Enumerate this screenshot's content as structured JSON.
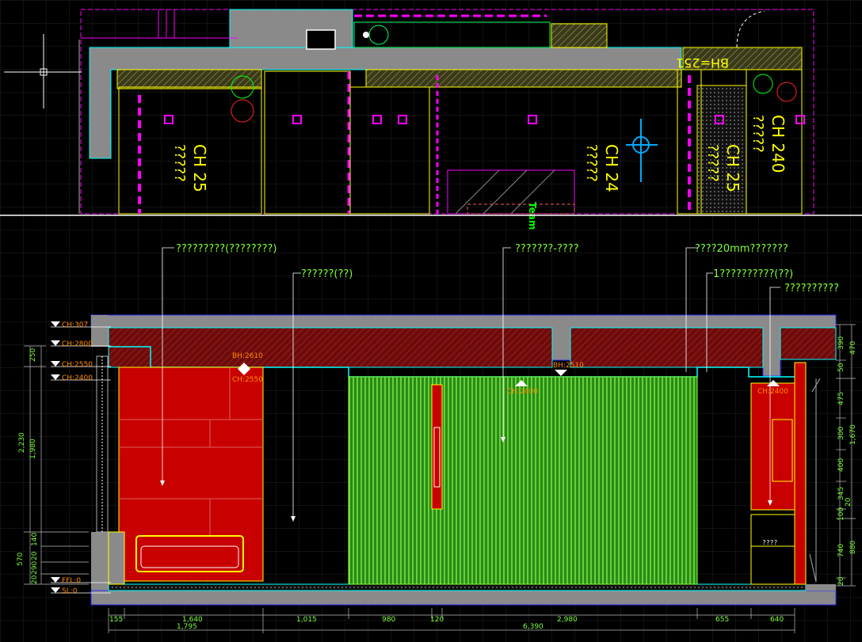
{
  "plan": {
    "room_labels": [
      {
        "code": "CH 25",
        "text": "?????"
      },
      {
        "code": "CH 24",
        "text": "?????"
      },
      {
        "code": "CH 25",
        "text": "?????"
      },
      {
        "code": "CH 240",
        "text": "?????"
      }
    ],
    "stamp": "BH=251",
    "tag": "Team"
  },
  "callouts": [
    "?????????(????????)",
    "??????(??)",
    "???????-????",
    "????20mm???????",
    "1??????????(??)",
    "??????????"
  ],
  "levels_left": [
    "CH:307",
    "CH:2800",
    "CH:2550",
    "CH:2400",
    "FFL:0",
    "SL:0"
  ],
  "ceiling_marks": [
    {
      "bh": "BH:2610",
      "ch": "CH:2550"
    },
    {
      "bh": "BH:2510",
      "ch": "CH:2400"
    },
    {
      "bh": "",
      "ch": "CH:2400"
    }
  ],
  "dims_bottom_1": [
    "155",
    "1,640",
    "1,015",
    "980",
    "120",
    "2,980",
    "655",
    "640"
  ],
  "dims_bottom_2": [
    "1,795",
    "6,390"
  ],
  "dims_left": [
    "250",
    "2,230",
    "1,980",
    "570",
    "140",
    "20",
    "290",
    "20"
  ],
  "dims_right_inner": [
    "390",
    "50",
    "475",
    "300",
    "400",
    "345",
    "20",
    "100",
    "740",
    "20"
  ],
  "dims_right_outer": [
    "470",
    "1,670",
    "880"
  ],
  "cabinet_label": "????",
  "colors": {
    "background": "#000000",
    "grid": "#1e1e1e",
    "concrete": "#808080",
    "red_panel": "#c80000",
    "hatch": "#7a1010",
    "green_panel": "#2e8f1f",
    "green_line": "#7cff3a",
    "magenta": "#ff00ff",
    "yellow": "#ffff00",
    "cyan": "#00ffff",
    "dim_green": "#00ff66",
    "orange": "#ff8a00",
    "blue": "#3030ff"
  }
}
